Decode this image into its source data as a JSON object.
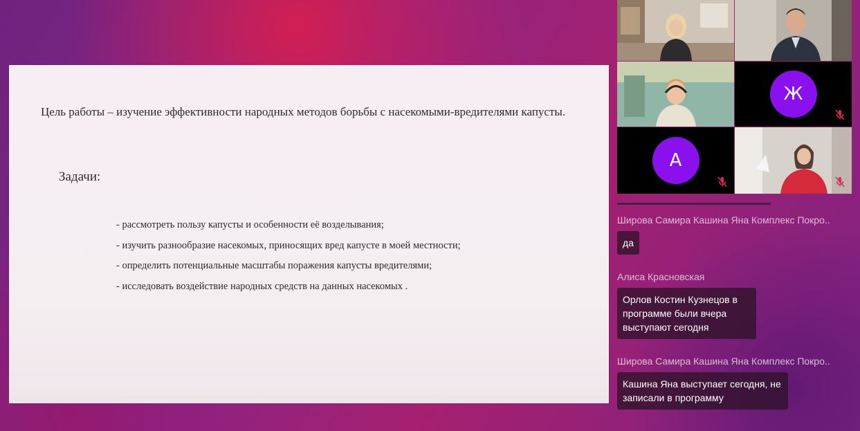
{
  "slide": {
    "goal": "Цель работы – изучение эффективности народных методов борьбы с насекомыми-вредителями капусты.",
    "tasks_title": "Задачи:",
    "tasks": [
      "- рассмотреть пользу капусты и особенности её возделывания;",
      "- изучить разнообразие насекомых, приносящих вред капусте в моей местности;",
      "- определить потенциальные масштабы поражения капусты вредителями;",
      "- исследовать воздействие народных средств на данных насекомых ."
    ]
  },
  "participants": [
    {
      "type": "video",
      "icon": "participant-video-woman-office"
    },
    {
      "type": "video",
      "icon": "participant-video-man-suit"
    },
    {
      "type": "video",
      "icon": "participant-video-boy-headset"
    },
    {
      "type": "avatar",
      "initial": "Ж",
      "color": "#8a10ee",
      "muted": true
    },
    {
      "type": "avatar",
      "initial": "А",
      "color": "#8a10ee",
      "muted": true
    },
    {
      "type": "video",
      "icon": "participant-video-woman-red",
      "muted": true
    }
  ],
  "chat": {
    "messages": [
      {
        "sender": "Широва Самира Кашина Яна Комплекс Покро..",
        "text": "да"
      },
      {
        "sender": "Алиса Красновская",
        "text": "Орлов Костин Кузнецов в программе были вчера выступают сегодня"
      },
      {
        "sender": "Широва Самира Кашина Яна Комплекс Покро..",
        "text": "Кашина Яна выступает сегодня, не записали в программу"
      }
    ]
  },
  "colors": {
    "avatar": "#8a10ee",
    "bubble": "#2a1223",
    "muted_icon": "#e0245e"
  }
}
